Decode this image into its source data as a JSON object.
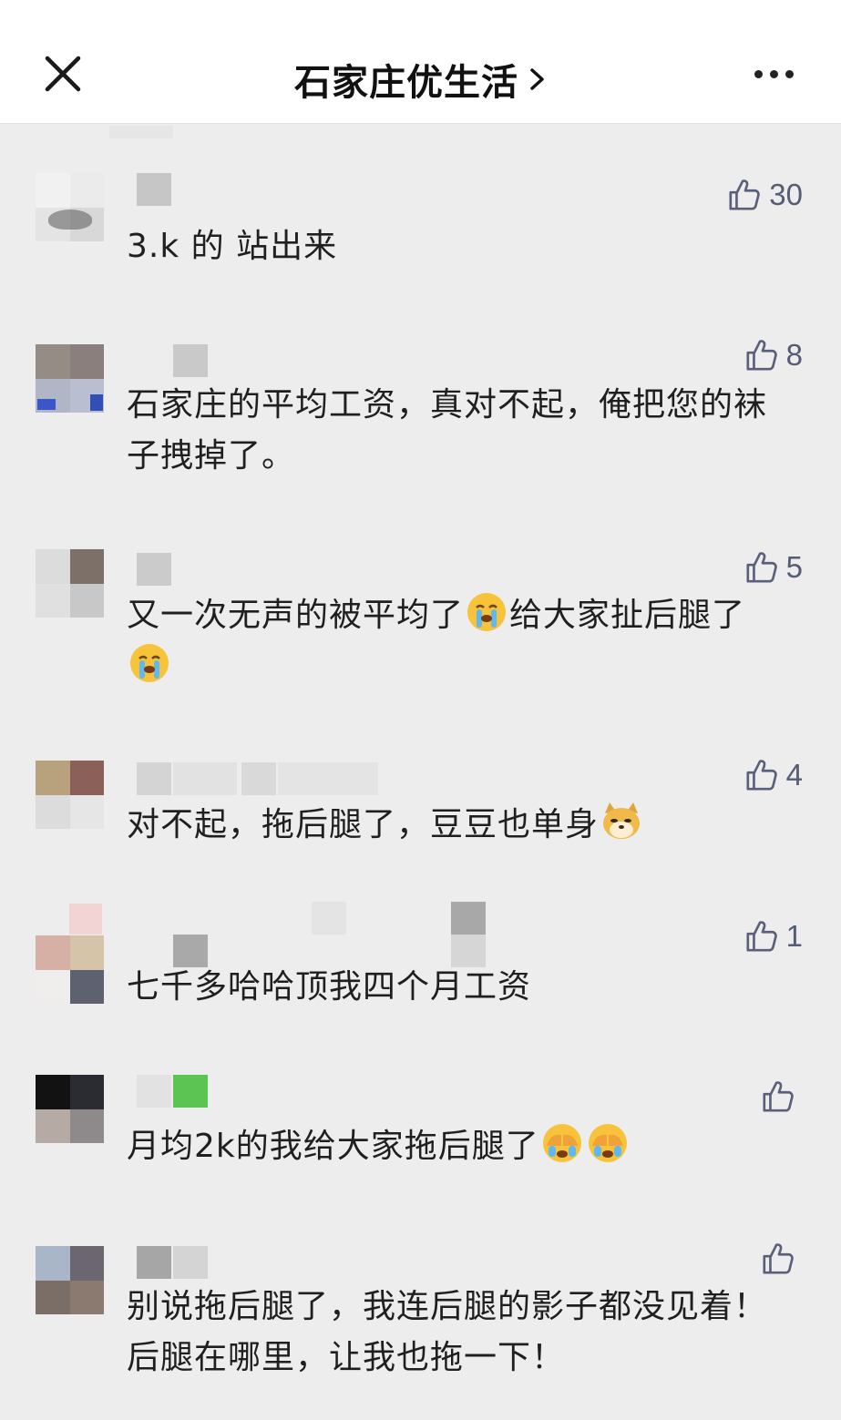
{
  "header": {
    "title": "石家庄优生活",
    "title_chevron": "›"
  },
  "comments": [
    {
      "text": "3.k 的 站出来",
      "likes": "30"
    },
    {
      "text": "石家庄的平均工资，真对不起，俺把您的袜子拽掉了。",
      "likes": "8"
    },
    {
      "text_a": "又一次无声的被平均了",
      "text_b": "给大家扯后腿了",
      "likes": "5",
      "emoji": "crying-emoji"
    },
    {
      "text": "对不起，拖后腿了，豆豆也单身",
      "likes": "4",
      "emoji": "doge-emoji"
    },
    {
      "text": "七千多哈哈顶我四个月工资",
      "likes": "1"
    },
    {
      "text": "月均2k的我给大家拖后腿了",
      "likes": "",
      "emoji": "facepalm-emoji"
    },
    {
      "text": "别说拖后腿了，我连后腿的影子都没见着！后腿在哪里，让我也拖一下！",
      "likes": ""
    }
  ],
  "colors": {
    "background": "#ededed",
    "header_bg": "#ffffff",
    "like_icon": "#5a6079"
  }
}
